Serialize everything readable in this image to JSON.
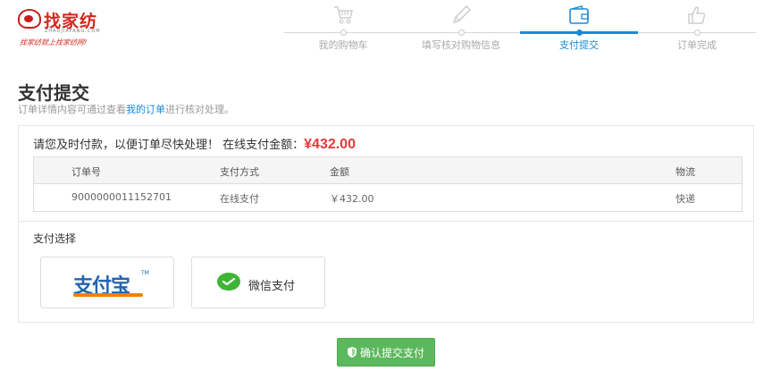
{
  "brand": {
    "name": "找家纺",
    "domain": "ZHAOJIAFANG.COM",
    "slogan": "找家纺就上找家纺网!",
    "color": "#d7261d"
  },
  "steps": [
    {
      "label": "我的购物车",
      "icon": "cart-icon",
      "active": false
    },
    {
      "label": "填写核对购物信息",
      "icon": "pencil-icon",
      "active": false
    },
    {
      "label": "支付提交",
      "icon": "wallet-icon",
      "active": true
    },
    {
      "label": "订单完成",
      "icon": "thumbs-up-icon",
      "active": false
    }
  ],
  "page": {
    "title": "支付提交",
    "desc_before": "订单详情内容可通过查看",
    "desc_link": "我的订单",
    "desc_after": "进行核对处理。"
  },
  "order": {
    "prompt": "请您及时付款，以便订单尽快处理！ 在线支付金额：",
    "amount": "¥432.00",
    "columns": [
      "订单号",
      "支付方式",
      "金额",
      "物流"
    ],
    "rows": [
      [
        "9000000011152701",
        "在线支付",
        "￥432.00",
        "快递"
      ]
    ]
  },
  "payment": {
    "heading": "支付选择",
    "alipay_label": "支付宝",
    "alipay_tm": "TM",
    "wechat_label": "微信支付"
  },
  "submit": {
    "label": "确认提交支付"
  },
  "colors": {
    "accent": "#1a8ad6",
    "price": "#e4393c",
    "button": "#5cb85c",
    "wechat": "#3fb534",
    "alipay": "#2263b0"
  }
}
